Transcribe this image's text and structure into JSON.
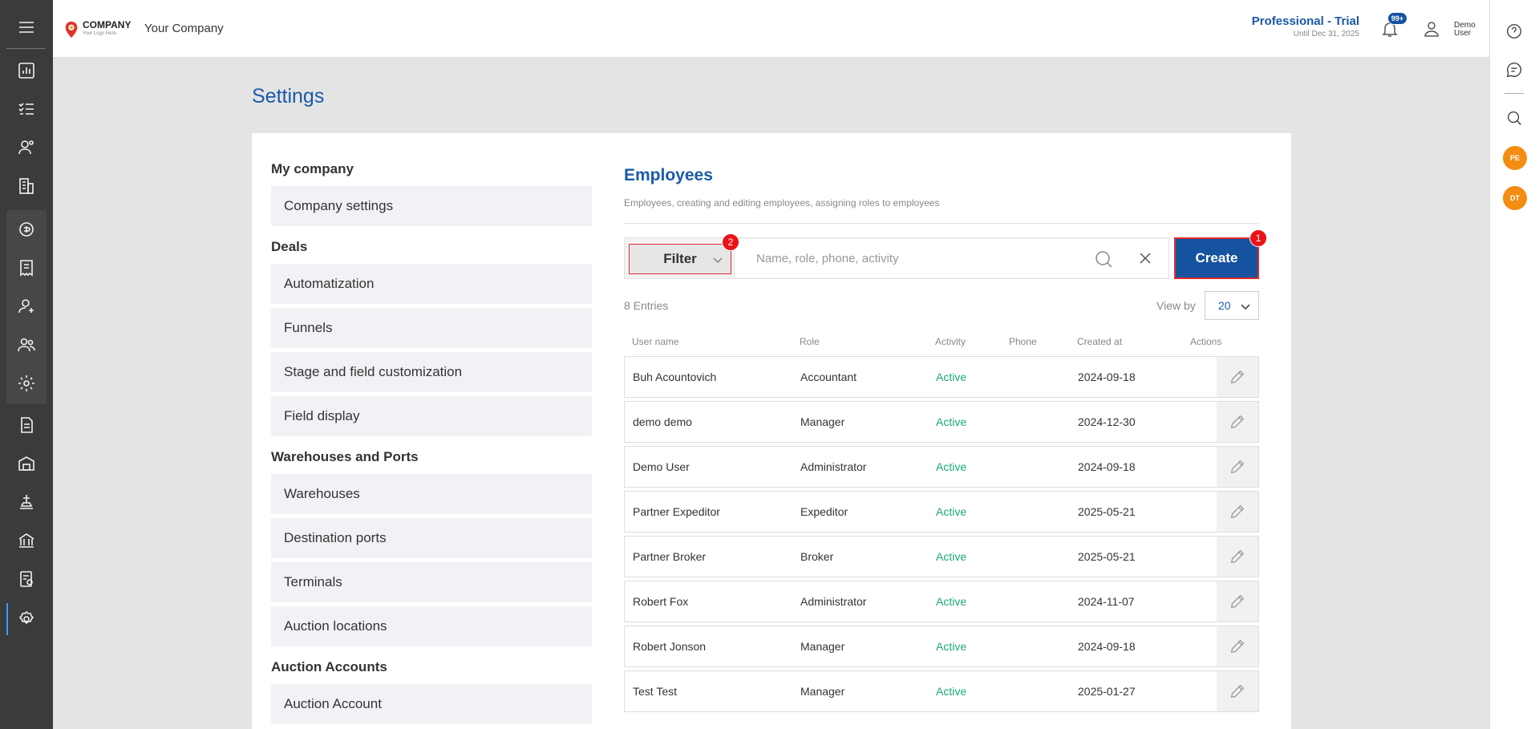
{
  "header": {
    "logo_text": "COMPANY",
    "logo_sub": "Your Logo Here",
    "company_name": "Your Company",
    "plan_title": "Professional - Trial",
    "plan_until": "Until Dec 31, 2025",
    "notification_badge": "99+",
    "user_name": "Demo User"
  },
  "sidebar": {
    "icons": [
      "menu-icon",
      "dashboard-icon",
      "tasks-icon",
      "contacts-icon",
      "companies-icon",
      "deals-icon",
      "invoices-icon",
      "client-icon",
      "team-icon",
      "gear-icon-group",
      "document-icon",
      "warehouse-icon",
      "port-icon",
      "auction-icon",
      "report-icon",
      "settings-icon"
    ]
  },
  "rightbar": {
    "avatars": [
      "PE",
      "DT"
    ]
  },
  "page": {
    "title": "Settings"
  },
  "settings_nav": {
    "sections": [
      {
        "title": "My company",
        "items": [
          "Company settings"
        ]
      },
      {
        "title": "Deals",
        "items": [
          "Automatization",
          "Funnels",
          "Stage and field customization",
          "Field display"
        ]
      },
      {
        "title": "Warehouses and Ports",
        "items": [
          "Warehouses",
          "Destination ports",
          "Terminals",
          "Auction locations"
        ]
      },
      {
        "title": "Auction Accounts",
        "items": [
          "Auction Account"
        ]
      }
    ]
  },
  "employees": {
    "title": "Employees",
    "subtitle": "Employees, creating and editing employees, assigning roles to employees",
    "filter_label": "Filter",
    "search_placeholder": "Name, role, phone, activity",
    "create_label": "Create",
    "marker_create": "1",
    "marker_filter": "2",
    "entries": "8 Entries",
    "viewby_label": "View by",
    "viewby_value": "20",
    "columns": [
      "User name",
      "Role",
      "Activity",
      "Phone",
      "Created at",
      "Actions"
    ],
    "rows": [
      {
        "name": "Buh Acountovich",
        "role": "Accountant",
        "activity": "Active",
        "phone": "",
        "created": "2024-09-18"
      },
      {
        "name": "demo demo",
        "role": "Manager",
        "activity": "Active",
        "phone": "",
        "created": "2024-12-30"
      },
      {
        "name": "Demo User",
        "role": "Administrator",
        "activity": "Active",
        "phone": "",
        "created": "2024-09-18"
      },
      {
        "name": "Partner Expeditor",
        "role": "Expeditor",
        "activity": "Active",
        "phone": "",
        "created": "2025-05-21"
      },
      {
        "name": "Partner Broker",
        "role": "Broker",
        "activity": "Active",
        "phone": "",
        "created": "2025-05-21"
      },
      {
        "name": "Robert Fox",
        "role": "Administrator",
        "activity": "Active",
        "phone": "",
        "created": "2024-11-07"
      },
      {
        "name": "Robert Jonson",
        "role": "Manager",
        "activity": "Active",
        "phone": "",
        "created": "2024-09-18"
      },
      {
        "name": "Test Test",
        "role": "Manager",
        "activity": "Active",
        "phone": "",
        "created": "2025-01-27"
      }
    ]
  },
  "colors": {
    "accent": "#1a5aa8",
    "primary_button": "#1552a0",
    "active_status": "#1aa87a",
    "marker": "#e8141a",
    "avatar": "#f28c13"
  }
}
